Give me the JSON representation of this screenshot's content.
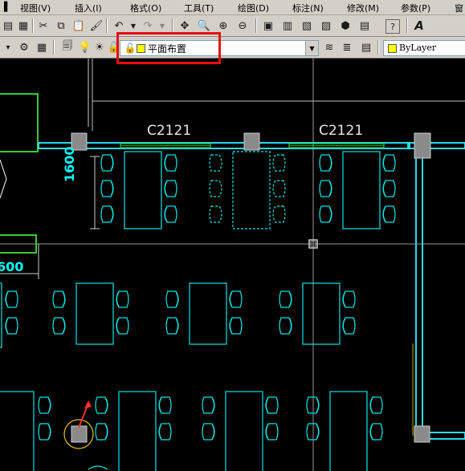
{
  "menu": [
    {
      "label": "视图(V)"
    },
    {
      "label": "插入(I)"
    },
    {
      "label": "格式(O)"
    },
    {
      "label": "工具(T)"
    },
    {
      "label": "绘图(D)"
    },
    {
      "label": "标注(N)"
    },
    {
      "label": "修改(M)"
    },
    {
      "label": "参数(P)"
    },
    {
      "label": "窗"
    }
  ],
  "toolbar": {
    "icons": [
      "cut-icon",
      "copy-icon",
      "paste-icon",
      "match-properties-icon",
      "undo-icon",
      "redo-icon",
      "pan-icon",
      "zoom-realtime-icon",
      "zoom-window-icon",
      "zoom-previous-icon",
      "properties-icon",
      "design-center-icon",
      "tool-palettes-icon",
      "sheet-set-icon",
      "markup-icon",
      "calculator-icon",
      "help-icon",
      "text-style-icon"
    ]
  },
  "layer_toolbar": {
    "current_layer": "平面布置",
    "layer_color": "#ffff00"
  },
  "properties_toolbar": {
    "color": "ByLayer",
    "color_swatch": "#ffff00"
  },
  "drawing": {
    "window_labels": [
      "C2121",
      "C2121"
    ],
    "dimensions": [
      "1600",
      "600"
    ],
    "entity_color": "#00e5e5",
    "wall_color": "#28f0ff"
  }
}
